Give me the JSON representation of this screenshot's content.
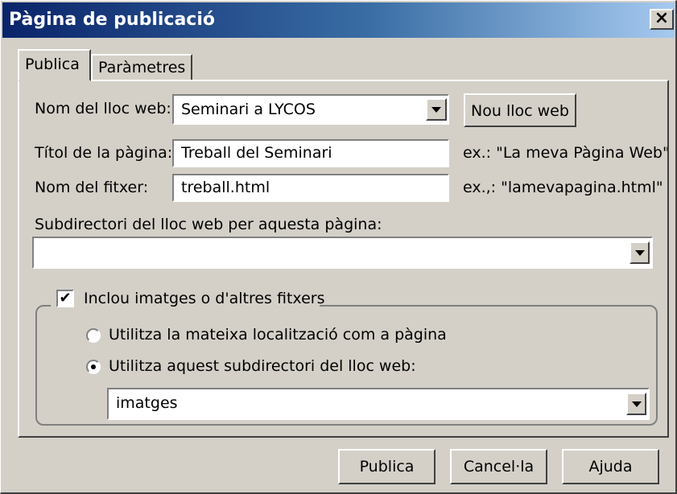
{
  "window": {
    "title": "Pàgina de publicació",
    "close_glyph": "×"
  },
  "tabs": [
    {
      "label": "Publica",
      "active": true
    },
    {
      "label": "Paràmetres",
      "active": false
    }
  ],
  "site": {
    "label": "Nom del lloc web:",
    "value": "Seminari a LYCOS",
    "new_site_button": "Nou lloc web"
  },
  "page_title": {
    "label": "Títol de la pàgina:",
    "value": "Treball del Seminari",
    "example": "ex.: \"La meva Pàgina Web\""
  },
  "file_name": {
    "label": "Nom del fitxer:",
    "value": "treball.html",
    "example": "ex.,: \"lamevapagina.html\""
  },
  "subdirectory": {
    "label": "Subdirectori del lloc web per aquesta pàgina:",
    "value": ""
  },
  "include_images": {
    "label": "Inclou imatges o d'altres fitxers",
    "checked": true,
    "check_glyph": "✔",
    "options": [
      {
        "label": "Utilitza la mateixa localització com a pàgina",
        "selected": false
      },
      {
        "label": "Utilitza aquest subdirectori del lloc web:",
        "selected": true
      }
    ],
    "subdirectory_value": "imatges"
  },
  "buttons": {
    "publish": "Publica",
    "cancel": "Cancel·la",
    "help": "Ajuda"
  },
  "icons": [
    "close-icon",
    "dropdown-arrow-icon",
    "checkbox-check-icon",
    "radio-button-icon"
  ]
}
